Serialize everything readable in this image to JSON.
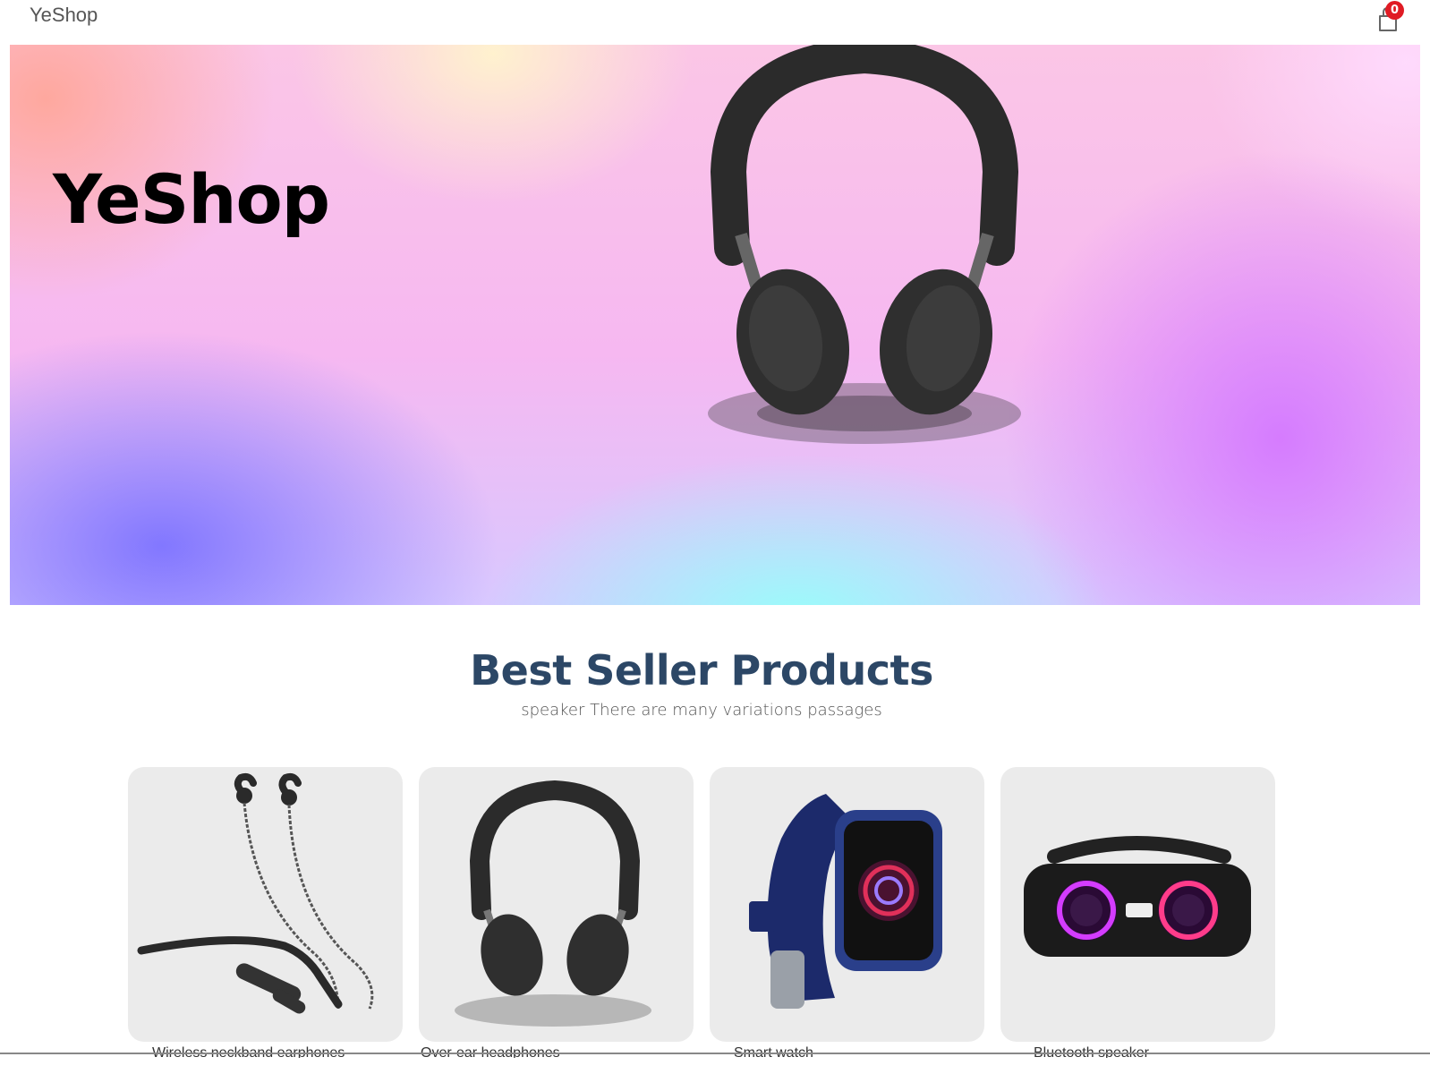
{
  "navbar": {
    "brand": "YeShop",
    "cart_icon": "shopping-bag-icon",
    "cart_count": "0"
  },
  "hero": {
    "title": "YeShop",
    "image": "headphones-image"
  },
  "best_sellers": {
    "title": "Best Seller Products",
    "subtitle": "speaker There are many variations passages",
    "products": [
      {
        "name": "Wireless neckband earphones",
        "image": "neckband-earphones-image"
      },
      {
        "name": "Over-ear headphones",
        "image": "headphones-image"
      },
      {
        "name": "Smart watch",
        "image": "smartwatch-image"
      },
      {
        "name": "Bluetooth speaker",
        "image": "boombox-speaker-image"
      }
    ]
  },
  "colors": {
    "heading": "#2c4766",
    "badge": "#e01b24",
    "card_bg": "#ebebeb"
  }
}
